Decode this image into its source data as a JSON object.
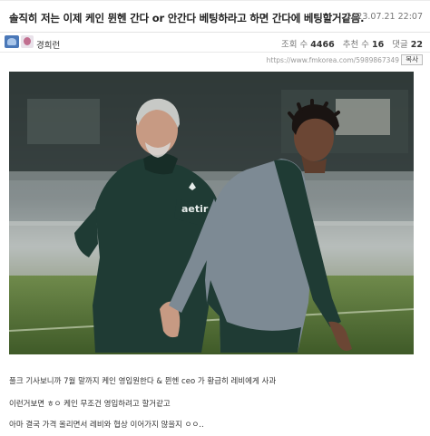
{
  "post": {
    "title": "솔직히 저는 이제 케인 뮌헨 간다 or 안간다 베팅하라고 하면 간다에 베팅할거같음.",
    "date": "2023.07.21 22:07",
    "author": "경희런",
    "views_label": "조회 수",
    "views": "4466",
    "recommend_label": "추천 수",
    "recommend": "16",
    "comments_label": "댓글",
    "comments": "22",
    "url": "https://www.fmkorea.com/5989867349",
    "copy_label": "복사"
  },
  "body": {
    "lines": [
      "풀크 기사보니까 7월 말까지 케인 영입원한다 & 뮌헨 ceo 가 황급히 레비에게 사과",
      "이런거보면 ㅎㅇ 케인 무조건 영입하려고 할거같고",
      "아마 결국 가격 올리면서 레비와 협상 이어가지 않을지 ㅇㅇ.."
    ]
  },
  "icons": {
    "author_badge": "member-badge-icon",
    "author_avatar": "avatar-icon"
  },
  "colors": {
    "title": "#222222",
    "meta": "#777777",
    "kit_green": "#1f3b34",
    "kit_grey": "#7d8a94"
  }
}
